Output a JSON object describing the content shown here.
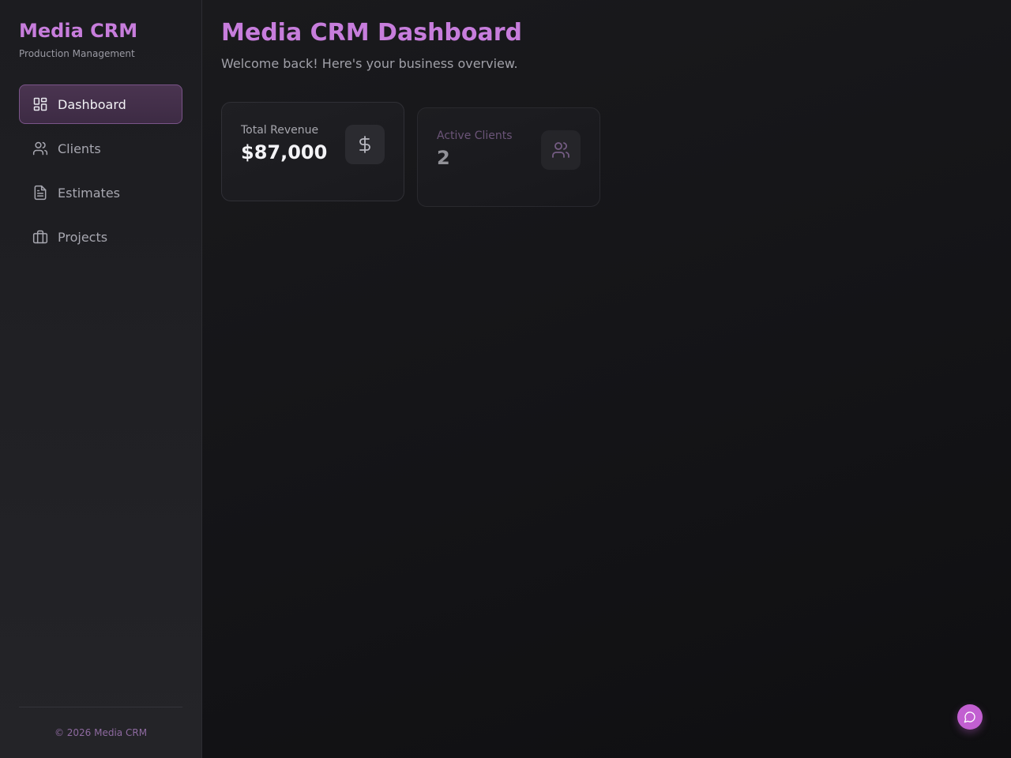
{
  "brand": {
    "title": "Media CRM",
    "subtitle": "Production Management"
  },
  "nav": {
    "items": [
      {
        "label": "Dashboard",
        "icon": "dashboard-grid-icon",
        "active": true
      },
      {
        "label": "Clients",
        "icon": "users-icon",
        "active": false
      },
      {
        "label": "Estimates",
        "icon": "document-icon",
        "active": false
      },
      {
        "label": "Projects",
        "icon": "briefcase-icon",
        "active": false
      }
    ]
  },
  "footer": {
    "text": "© 2026 Media CRM"
  },
  "header": {
    "title": "Media CRM Dashboard",
    "subtitle": "Welcome back! Here's your business overview."
  },
  "stats": [
    {
      "label": "Total Revenue",
      "value": "$87,000",
      "icon": "dollar-icon"
    },
    {
      "label": "Active Clients",
      "value": "2",
      "icon": "users-icon"
    }
  ],
  "chat_button": {
    "icon": "chat-bubble-icon"
  },
  "colors": {
    "accent": "#c77ddc",
    "active_nav_bg": "#4a3450",
    "fab": "#c25fd1",
    "background": "#131316"
  }
}
